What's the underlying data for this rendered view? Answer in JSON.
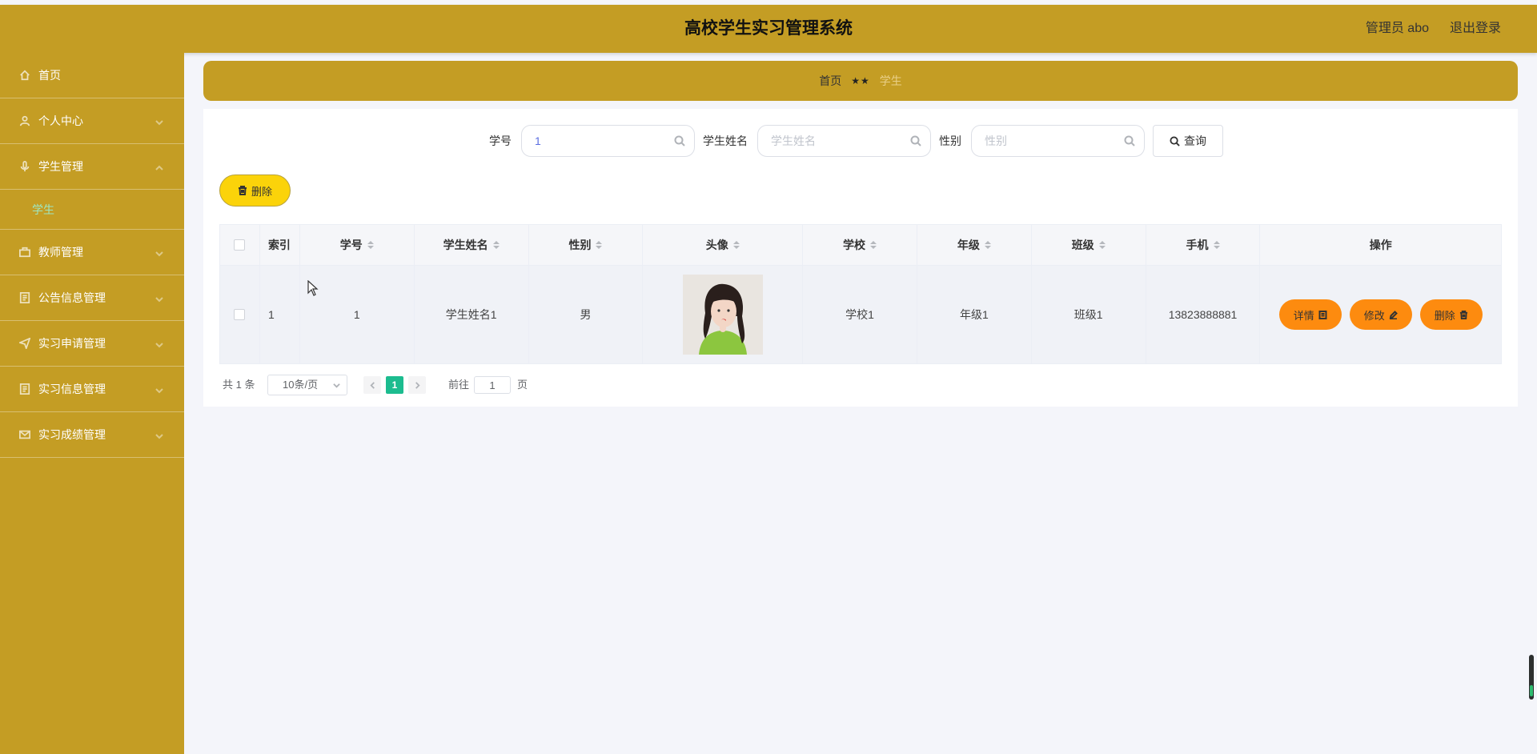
{
  "header": {
    "title": "高校学生实习管理系统",
    "user_label": "管理员 abo",
    "logout_label": "退出登录"
  },
  "sidebar": {
    "items": [
      {
        "label": "首页",
        "icon": "home-icon"
      },
      {
        "label": "个人中心",
        "icon": "user-icon"
      },
      {
        "label": "学生管理",
        "icon": "microphone-icon"
      },
      {
        "label": "学生",
        "icon": ""
      },
      {
        "label": "教师管理",
        "icon": "briefcase-icon"
      },
      {
        "label": "公告信息管理",
        "icon": "document-icon"
      },
      {
        "label": "实习申请管理",
        "icon": "send-icon"
      },
      {
        "label": "实习信息管理",
        "icon": "document-icon"
      },
      {
        "label": "实习成绩管理",
        "icon": "mail-icon"
      }
    ]
  },
  "breadcrumb": {
    "home": "首页",
    "separator": "★★",
    "current": "学生"
  },
  "search": {
    "student_no_label": "学号",
    "student_no_value": "1",
    "student_no_placeholder": "学号",
    "name_label": "学生姓名",
    "name_placeholder": "学生姓名",
    "gender_label": "性别",
    "gender_placeholder": "性别",
    "query_label": "查询"
  },
  "toolbar": {
    "delete_label": "删除"
  },
  "table": {
    "columns": [
      "索引",
      "学号",
      "学生姓名",
      "性别",
      "头像",
      "学校",
      "年级",
      "班级",
      "手机",
      "操作"
    ],
    "rows": [
      {
        "index": "1",
        "student_no": "1",
        "name": "学生姓名1",
        "gender": "男",
        "school": "学校1",
        "grade": "年级1",
        "class": "班级1",
        "phone": "13823888881"
      }
    ],
    "actions": {
      "detail": "详情",
      "edit": "修改",
      "delete": "删除"
    }
  },
  "pagination": {
    "total": "共 1 条",
    "page_size": "10条/页",
    "current_page": "1",
    "goto_label": "前往",
    "goto_value": "1",
    "page_suffix": "页"
  },
  "colors": {
    "brand": "#c49d24",
    "action_orange": "#fd8b0f",
    "batch_yellow": "#fbd30a",
    "active_page": "#1cbc8f",
    "active_menu_text": "#9ee7c2"
  }
}
